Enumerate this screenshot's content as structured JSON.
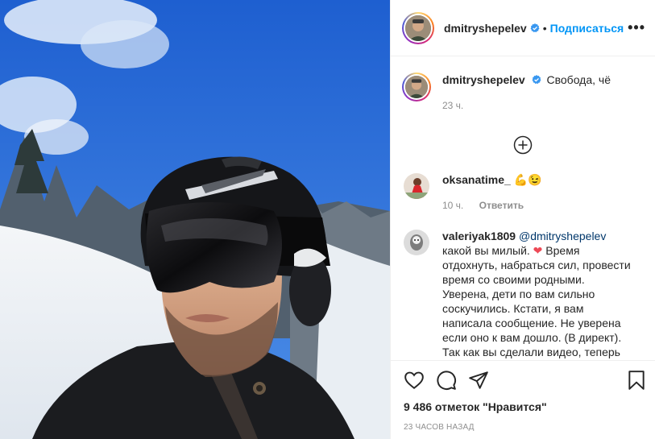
{
  "post": {
    "username": "dmitryshepelev",
    "follow_label": "Подписаться",
    "dot": "•",
    "more": "•••",
    "caption": "Свобода, чё",
    "caption_time": "23 ч.",
    "likes_text": "9 486 отметок \"Нравится\"",
    "timestamp": "23 часов назад"
  },
  "comments": [
    {
      "username": "oksanatime_",
      "text": "💪😉",
      "time": "10 ч.",
      "reply_label": "Ответить"
    },
    {
      "username": "valeriyak1809",
      "mention": "@dmitryshepelev",
      "text_part1": " какой вы милый. ",
      "heart": "❤",
      "text_part2": " Время отдохнуть, набраться сил, провести время со своими родными. Уверена, дети по вам сильно соскучились. Кстати, я вам написала сообщение. Не уверена если оно к вам дошло. (В директ). Так как вы сделали видео, теперь тоже хочется в горы. 😄"
    }
  ],
  "icons": {
    "like": "heart-icon",
    "comment": "comment-icon",
    "share": "share-icon",
    "save": "bookmark-icon",
    "load_more": "plus-circle-icon",
    "verified": "verified-badge-icon"
  },
  "colors": {
    "accent": "#0095f6",
    "verified": "#3897f0",
    "muted": "#8e8e8e",
    "text": "#262626",
    "heart": "#ed4956"
  }
}
